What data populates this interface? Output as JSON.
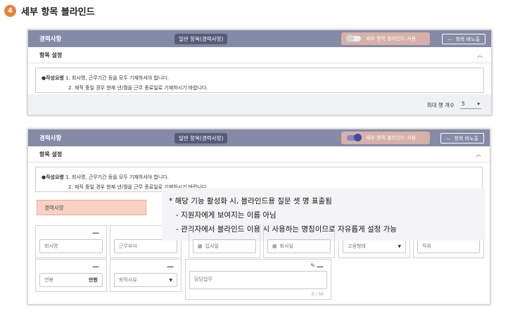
{
  "step": {
    "number": "4",
    "title": "세부 항목 블라인드"
  },
  "shot1": {
    "section_title": "경력사항",
    "category_pill": "일반 항목(경력사항)",
    "toggle_label": "세부 항목 블라인드 사용",
    "toggle_on": false,
    "fold_button": "항목 바노출",
    "item_setting": "항목 설정",
    "guide_line1_prefix": "●작성요령",
    "guide_line1": "1. 회사명, 근무기간 등을 모두 기재하셔야 합니다.",
    "guide_line2": "2. 재직 중일 경우 현재 년/월을 근무 종료일로 기재하시기 바랍니다.",
    "max_rows_label": "최대 행 개수",
    "max_rows_value": "5"
  },
  "shot2": {
    "section_title": "경력사항",
    "category_pill": "일반 항목(경력사항)",
    "toggle_label": "세부 항목 블라인드 사용",
    "toggle_on": true,
    "fold_button": "항목 바노출",
    "item_setting": "항목 설정",
    "guide_line1_prefix": "●작성요령",
    "guide_line1": "1. 회사명, 근무기간 등을 모두 기재하셔야 합니다.",
    "guide_line2": "2. 재직 중일 경우 현재 년/월을 근무 종료일로 기재하시기 바랍니다.",
    "blind_name": "경력사항",
    "fields": {
      "company": "회사명",
      "department": "근무부서",
      "join_date": "입사일",
      "leave_date": "퇴사일",
      "employment_type": "고용형태",
      "position": "직위",
      "salary": "연봉",
      "salary_unit": "만원",
      "leave_reason": "퇴직사유",
      "duties": "담당업무",
      "duties_count": "0 / 50"
    }
  },
  "tooltip": {
    "line1": "* 해당 기능 활성화 시, 블라인드용 질문 셋 명 표출됨",
    "line2": "-   지원자에게 보여지는 이름 아님",
    "line3": "-   관리자에서 블라인드 이용 시 사용하는 명칭이므로  자유롭게 설정 가능"
  },
  "colors": {
    "accent": "#e8833a",
    "header_bar": "#858aa6",
    "toggle_highlight": "#d7b0a8",
    "switch_on": "#3f4ca8"
  },
  "icons": {
    "fold": "minus-icon",
    "collapse": "chevron-up-icon",
    "calendar": "calendar-icon",
    "edit": "pencil-icon",
    "dropdown": "chevron-down-icon"
  }
}
